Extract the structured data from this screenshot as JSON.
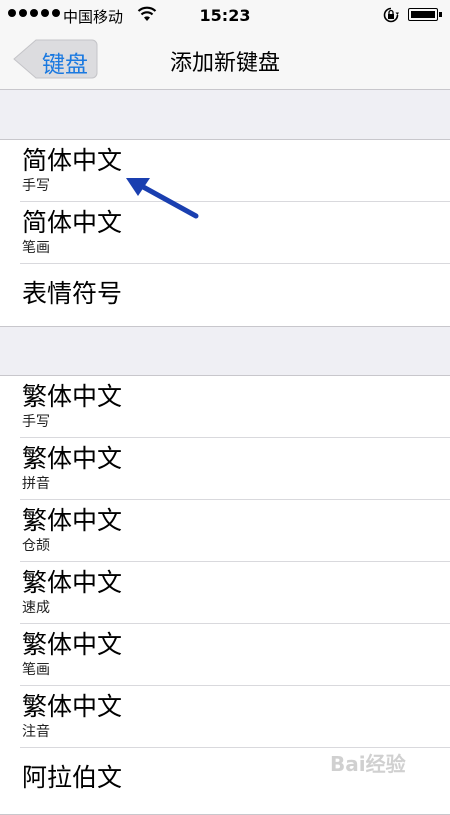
{
  "status_bar": {
    "carrier": "中国移动",
    "time": "15:23"
  },
  "nav": {
    "back_label": "键盘",
    "title": "添加新键盘"
  },
  "group1": [
    {
      "title": "简体中文",
      "subtitle": "手写"
    },
    {
      "title": "简体中文",
      "subtitle": "笔画"
    },
    {
      "title": "表情符号",
      "subtitle": ""
    }
  ],
  "group2": [
    {
      "title": "繁体中文",
      "subtitle": "手写"
    },
    {
      "title": "繁体中文",
      "subtitle": "拼音"
    },
    {
      "title": "繁体中文",
      "subtitle": "仓颉"
    },
    {
      "title": "繁体中文",
      "subtitle": "速成"
    },
    {
      "title": "繁体中文",
      "subtitle": "笔画"
    },
    {
      "title": "繁体中文",
      "subtitle": "注音"
    },
    {
      "title": "阿拉伯文",
      "subtitle": ""
    }
  ],
  "watermark": "Bai经验",
  "colors": {
    "accent": "#1a79e0",
    "arrow": "#1a3fb0"
  }
}
